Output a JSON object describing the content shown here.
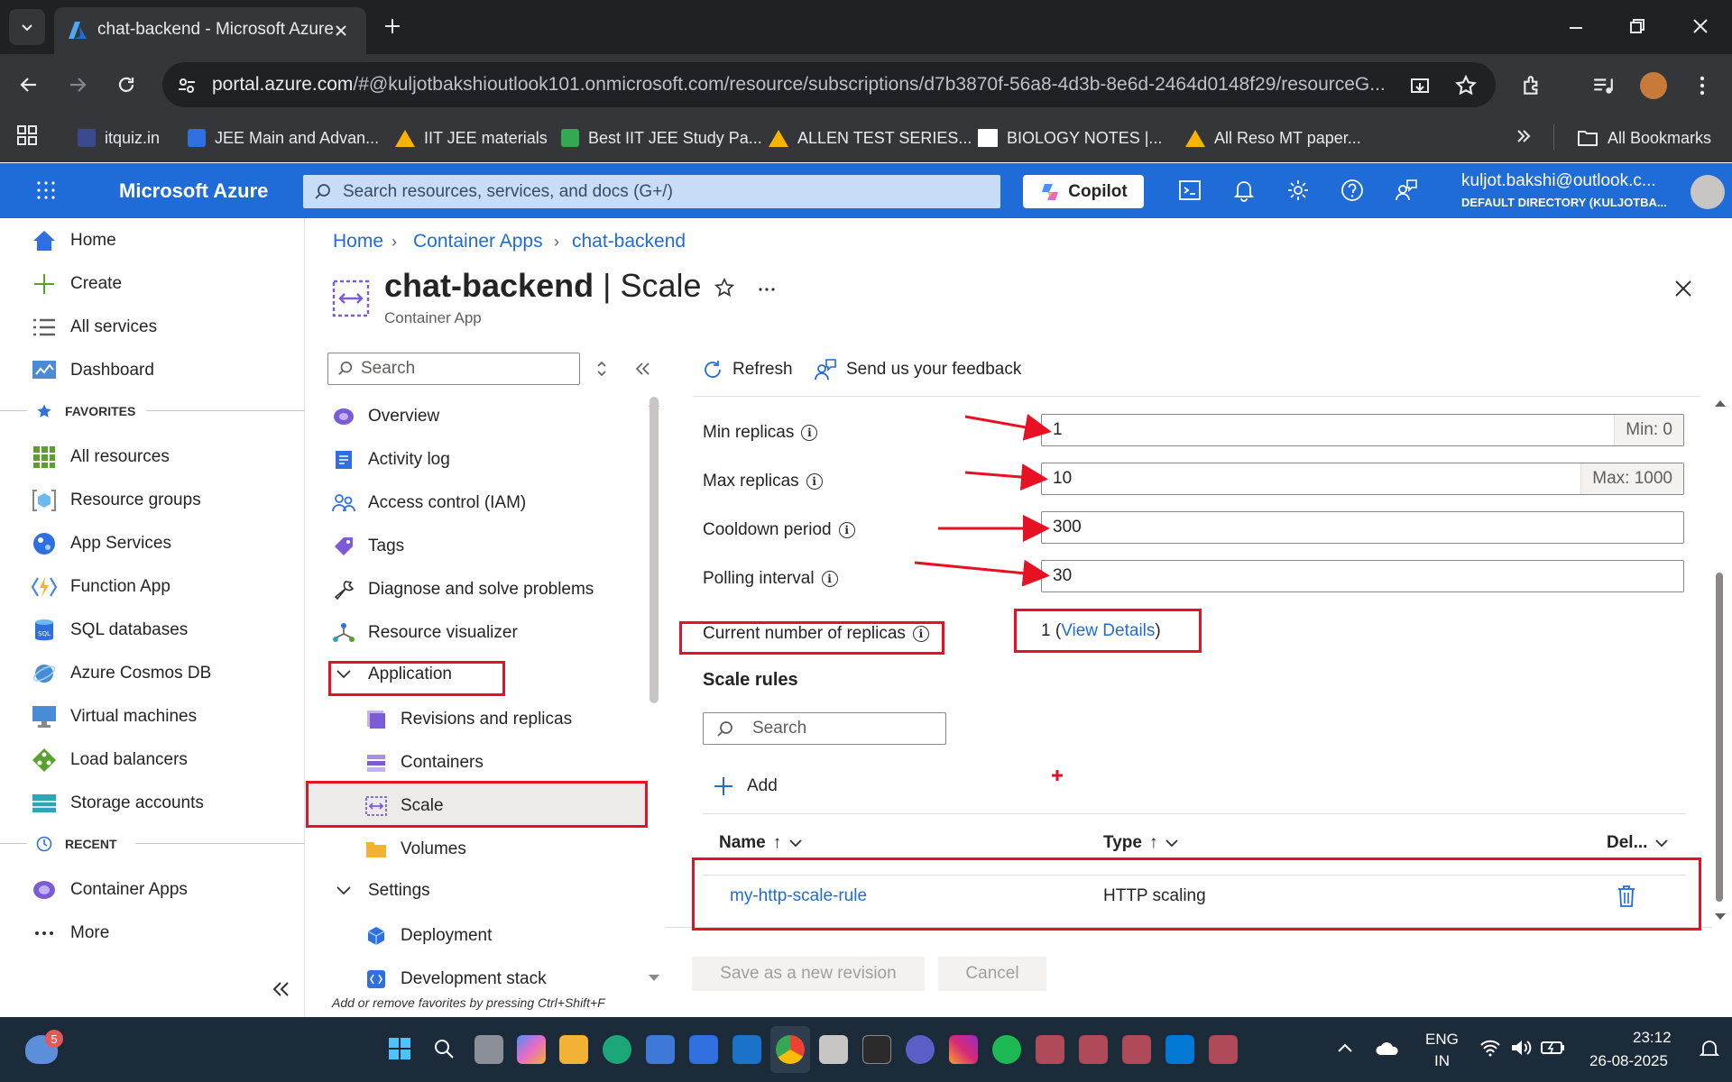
{
  "browser": {
    "tab_title": "chat-backend - Microsoft Azure",
    "url_host": "portal.azure.com",
    "url_path": "/#@kuljotbakshioutlook101.onmicrosoft.com/resource/subscriptions/d7b3870f-56a8-4d3b-8e6d-2464d0148f29/resourceG...",
    "bookmarks": [
      "itquiz.in",
      "JEE Main and Advan...",
      "IIT JEE materials",
      "Best IIT JEE Study Pa...",
      "ALLEN TEST SERIES...",
      "BIOLOGY NOTES |...",
      "All Reso MT paper..."
    ],
    "all_bookmarks": "All Bookmarks"
  },
  "azure_header": {
    "brand": "Microsoft Azure",
    "search_placeholder": "Search resources, services, and docs (G+/)",
    "copilot": "Copilot",
    "user_email": "kuljot.bakshi@outlook.c...",
    "user_directory": "DEFAULT DIRECTORY (KULJOTBA..."
  },
  "left_nav": {
    "top": [
      "Home",
      "Create",
      "All services",
      "Dashboard"
    ],
    "favorites_label": "FAVORITES",
    "favorites": [
      "All resources",
      "Resource groups",
      "App Services",
      "Function App",
      "SQL databases",
      "Azure Cosmos DB",
      "Virtual machines",
      "Load balancers",
      "Storage accounts"
    ],
    "recent_label": "RECENT",
    "recent": [
      "Container Apps"
    ],
    "more": "More"
  },
  "breadcrumb": [
    "Home",
    "Container Apps",
    "chat-backend"
  ],
  "resource": {
    "name": "chat-backend",
    "blade": "Scale",
    "separator": " | ",
    "type": "Container App"
  },
  "resource_menu": {
    "search_placeholder": "Search",
    "items": [
      "Overview",
      "Activity log",
      "Access control (IAM)",
      "Tags",
      "Diagnose and solve problems",
      "Resource visualizer"
    ],
    "application_group": "Application",
    "application_items": [
      "Revisions and replicas",
      "Containers",
      "Scale",
      "Volumes"
    ],
    "settings_group": "Settings",
    "settings_items": [
      "Deployment",
      "Development stack"
    ],
    "favorites_hint": "Add or remove favorites by pressing Ctrl+Shift+F"
  },
  "commands": {
    "refresh": "Refresh",
    "feedback": "Send us your feedback"
  },
  "scale_form": {
    "min_replicas_label": "Min replicas",
    "min_replicas_value": "1",
    "min_suffix": "Min: 0",
    "max_replicas_label": "Max replicas",
    "max_replicas_value": "10",
    "max_suffix": "Max: 1000",
    "cooldown_label": "Cooldown period",
    "cooldown_value": "300",
    "polling_label": "Polling interval",
    "polling_value": "30",
    "current_replicas_label": "Current number of replicas",
    "current_replicas_value": "1",
    "view_details": "View Details"
  },
  "scale_rules": {
    "heading": "Scale rules",
    "search_placeholder": "Search",
    "add": "Add",
    "columns": [
      "Name",
      "Type",
      "Del..."
    ],
    "rows": [
      {
        "name": "my-http-scale-rule",
        "type": "HTTP scaling"
      }
    ]
  },
  "footer": {
    "save": "Save as a new revision",
    "cancel": "Cancel"
  },
  "taskbar": {
    "badge": "5",
    "lang1": "ENG",
    "lang2": "IN",
    "time": "23:12",
    "date": "26-08-2025"
  },
  "colors": {
    "azure_blue": "#1f6bd8",
    "annotation_red": "#e81123",
    "chrome_dark": "#202124"
  }
}
